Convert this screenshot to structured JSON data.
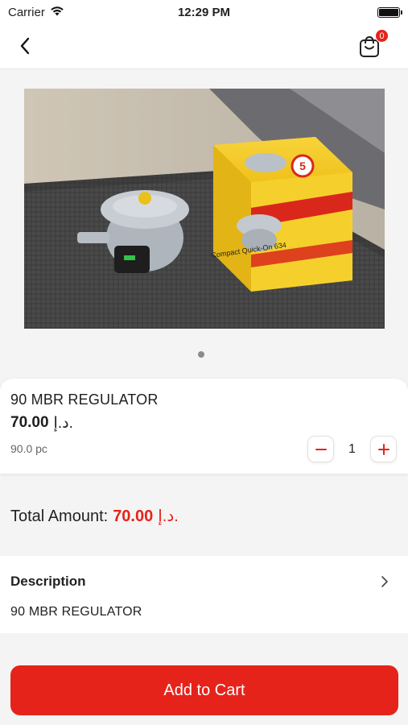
{
  "status_bar": {
    "carrier": "Carrier",
    "time": "12:29 PM"
  },
  "header": {
    "cart_count": "0"
  },
  "product": {
    "name": "90 MBR REGULATOR",
    "price": "70.00",
    "currency": "د.إ.",
    "unit": "90.0 pc",
    "quantity": "1",
    "image_count": 1,
    "image_box_text_1": "Compact Quick-On 634",
    "image_box_number": "5"
  },
  "total": {
    "label": "Total Amount:",
    "value": "70.00",
    "currency": "د.إ."
  },
  "description": {
    "title": "Description",
    "text": "90 MBR REGULATOR"
  },
  "actions": {
    "add_to_cart": "Add to Cart"
  },
  "colors": {
    "accent": "#e5231b",
    "background": "#f4f4f4"
  }
}
